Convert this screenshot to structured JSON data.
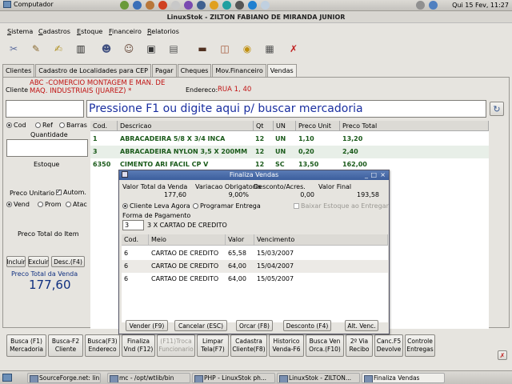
{
  "system_panel": {
    "computer_label": "Computador",
    "clock": "Qui 15 Fev, 11:27"
  },
  "window": {
    "title": "LinuxStok - ZILTON FABIANO DE MIRANDA JUNIOR"
  },
  "menu": [
    {
      "label": "Sistema",
      "ul": "S",
      "rest": "istema"
    },
    {
      "label": "Cadastros",
      "ul": "C",
      "rest": "adastros"
    },
    {
      "label": "Estoque",
      "ul": "E",
      "rest": "stoque"
    },
    {
      "label": "Financeiro",
      "ul": "F",
      "rest": "inanceiro"
    },
    {
      "label": "Relatorios",
      "ul": "R",
      "rest": "elatorios"
    }
  ],
  "tabs": [
    "Clientes",
    "Cadastro de Localidades para CEP",
    "Pagar",
    "Cheques",
    "Mov.Financeiro",
    "Vendas"
  ],
  "sale": {
    "cliente_label": "Cliente",
    "cliente_value": "ABC -COMERCIO MONTAGEM E MAN. DE MAQ. INDUSTRIAIS (JUAREZ) *",
    "endereco_label": "Endereco:",
    "endereco_value": "RUA 1, 40",
    "search_prompt": "Pressione F1 ou digite aqui p/ buscar mercadoria",
    "search_by": [
      "Cod",
      "Ref",
      "Barras"
    ],
    "quantidade_label": "Quantidade",
    "estoque_label": "Estoque",
    "preco_unitario_label": "Preco Unitario",
    "autom_label": "Autom.",
    "price_types": [
      "Vend",
      "Prom",
      "Atac"
    ],
    "preco_total_item_label": "Preco Total do Item",
    "incluir": "Incluir",
    "excluir": "Excluir",
    "desc": "Desc.(F4)",
    "preco_total_venda_label": "Preco Total da Venda",
    "preco_total_venda_value": "177,60"
  },
  "grid": {
    "headers": [
      "Cod.",
      "Descricao",
      "Qt",
      "UN",
      "Preco Unit",
      "Preco Total"
    ],
    "rows": [
      [
        "1",
        "ABRACADEIRA  5/8 X 3/4 INCA",
        "12",
        "UN",
        "1,10",
        "13,20"
      ],
      [
        "3",
        "ABRACADEIRA NYLON 3,5 X 200MM",
        "12",
        "UN",
        "0,20",
        "2,40"
      ],
      [
        "6350",
        "CIMENTO ARI FACIL CP V",
        "12",
        "SC",
        "13,50",
        "162,00"
      ]
    ]
  },
  "dialog": {
    "title": "Finaliza Vendas",
    "valor_total_label": "Valor Total da Venda",
    "valor_total_value": "177,60",
    "variacao_label": "Variacao Obrigatoria",
    "variacao_value": "9,00%",
    "desconto_label": "Desconto/Acres.",
    "desconto_value": "0,00",
    "valor_final_label": "Valor Final",
    "valor_final_value": "193,58",
    "cliente_leva_agora": "Cliente Leva Agora",
    "programar_entrega": "Programar Entrega",
    "baixar_estoque": "Baixar Estoque ao Entregar",
    "forma_pagamento_label": "Forma de Pagamento",
    "forma_pagamento_code": "3",
    "forma_pagamento_desc": "3 X CARTAO DE CREDITO",
    "headers": [
      "Cod.",
      "Meio",
      "Valor",
      "Vencimento"
    ],
    "rows": [
      [
        "6",
        "CARTAO DE CREDITO",
        "65,58",
        "15/03/2007"
      ],
      [
        "6",
        "CARTAO DE CREDITO",
        "64,00",
        "15/04/2007"
      ],
      [
        "6",
        "CARTAO DE CREDITO",
        "64,00",
        "15/05/2007"
      ]
    ],
    "buttons": [
      "Vender (F9)",
      "Cancelar (ESC)",
      "Orcar (F8)",
      "Desconto (F4)",
      "Alt. Venc."
    ]
  },
  "function_buttons": [
    [
      "Busca (F1)",
      "Mercadoria"
    ],
    [
      "Busca-F2",
      "Cliente"
    ],
    [
      "Busca(F3)",
      "Endereco"
    ],
    [
      "Finaliza",
      "Vnd (F12)"
    ],
    [
      "(F11)Troca",
      "Funcionario"
    ],
    [
      "Limpar",
      "Tela(F7)"
    ],
    [
      "Cadastra",
      "Cliente(F8)"
    ],
    [
      "Historico",
      "Venda-F6"
    ],
    [
      "Busca Ven",
      "Orca.(F10)"
    ],
    [
      "2º Via",
      "Recibo"
    ],
    [
      "Canc.F5",
      "Devolve"
    ],
    [
      "Controle",
      "Entregas"
    ]
  ],
  "taskbar": [
    "SourceForge.net: lin...",
    "mc - /opt/wtlib/bin",
    "PHP - LinuxStok ph...",
    "LinuxStok - ZILTON...",
    "Finaliza Vendas"
  ]
}
